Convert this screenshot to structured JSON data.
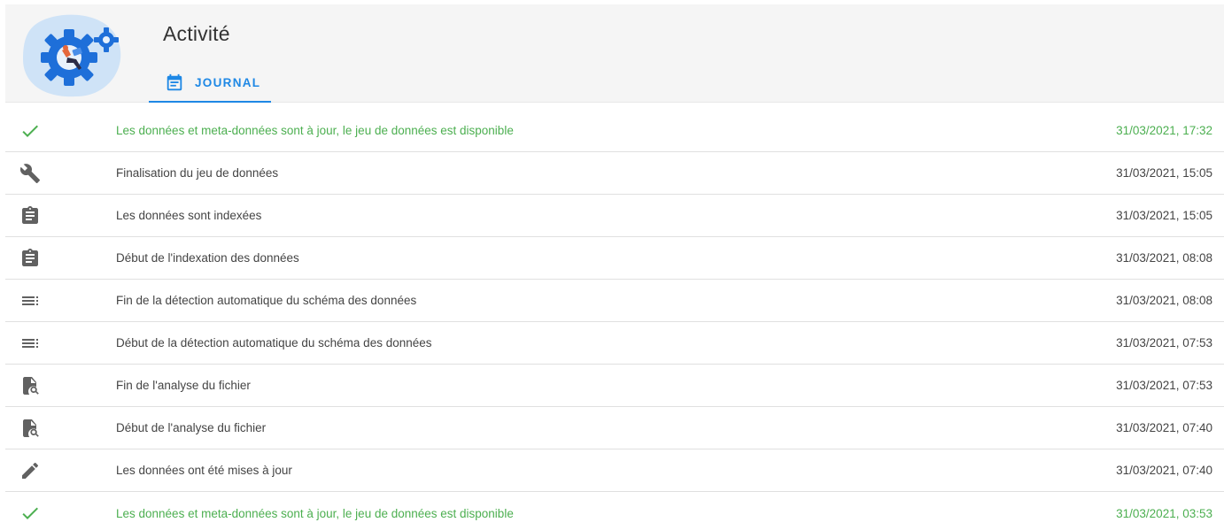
{
  "header": {
    "title": "Activité",
    "tab": {
      "label": "JOURNAL",
      "icon": "calendar-text-icon",
      "active": true
    }
  },
  "colors": {
    "accent": "#1e88e5",
    "success": "#4caf50",
    "icon_grey": "#616161",
    "illustration_blob": "#cfe3f7"
  },
  "log": [
    {
      "icon": "check-icon",
      "status": "success",
      "text": "Les données et meta-données sont à jour, le jeu de données est disponible",
      "date": "31/03/2021, 17:32"
    },
    {
      "icon": "wrench-icon",
      "status": "normal",
      "text": "Finalisation du jeu de données",
      "date": "31/03/2021, 15:05"
    },
    {
      "icon": "clipboard-text-icon",
      "status": "normal",
      "text": "Les données sont indexées",
      "date": "31/03/2021, 15:05"
    },
    {
      "icon": "clipboard-text-icon",
      "status": "normal",
      "text": "Début de l'indexation des données",
      "date": "31/03/2021, 08:08"
    },
    {
      "icon": "list-details-icon",
      "status": "normal",
      "text": "Fin de la détection automatique du schéma des données",
      "date": "31/03/2021, 08:08"
    },
    {
      "icon": "list-details-icon",
      "status": "normal",
      "text": "Début de la détection automatique du schéma des données",
      "date": "31/03/2021, 07:53"
    },
    {
      "icon": "file-search-icon",
      "status": "normal",
      "text": "Fin de l'analyse du fichier",
      "date": "31/03/2021, 07:53"
    },
    {
      "icon": "file-search-icon",
      "status": "normal",
      "text": "Début de l'analyse du fichier",
      "date": "31/03/2021, 07:40"
    },
    {
      "icon": "pencil-icon",
      "status": "normal",
      "text": "Les données ont été mises à jour",
      "date": "31/03/2021, 07:40"
    },
    {
      "icon": "check-icon",
      "status": "success",
      "text": "Les données et meta-données sont à jour, le jeu de données est disponible",
      "date": "31/03/2021, 03:53"
    }
  ]
}
